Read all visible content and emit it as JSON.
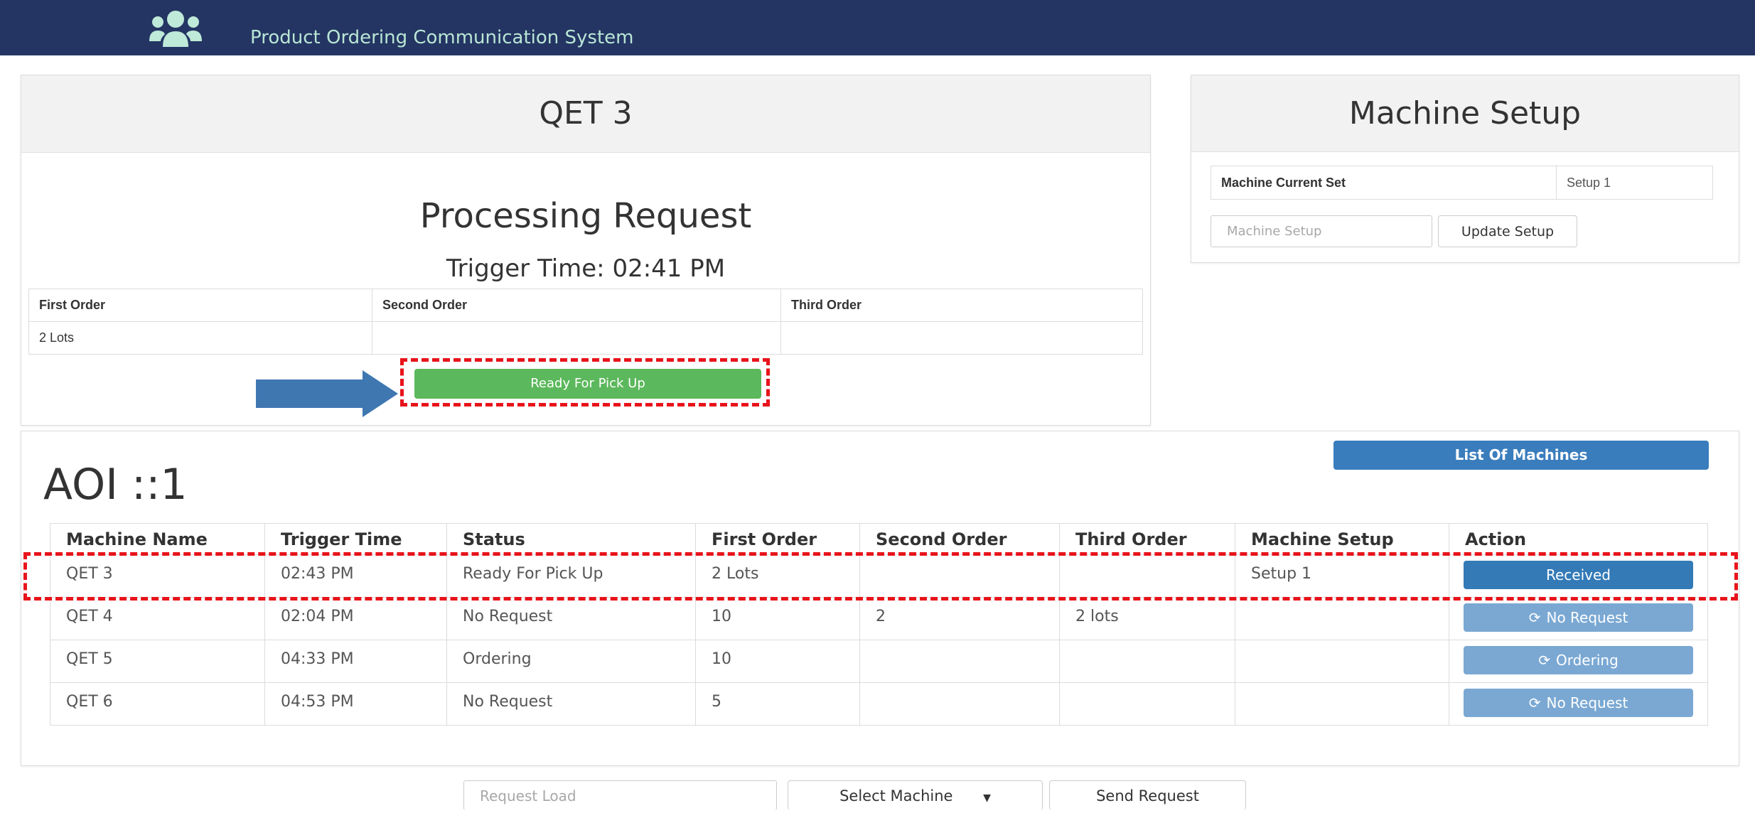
{
  "header": {
    "app_title": "Product Ordering Communication System",
    "logo_icon": "users-group-icon"
  },
  "processing_panel": {
    "title": "QET 3",
    "heading": "Processing Request",
    "trigger_label": "Trigger Time: 02:41 PM",
    "columns": [
      "First Order",
      "Second Order",
      "Third Order"
    ],
    "values": [
      "2 Lots",
      "",
      ""
    ],
    "status_button": "Ready For Pick Up"
  },
  "machine_setup": {
    "title": "Machine Setup",
    "current_label": "Machine Current Set",
    "current_value": "Setup 1",
    "input_placeholder": "Machine Setup",
    "update_button": "Update Setup"
  },
  "aoi": {
    "title": "AOI ::1",
    "list_button": "List Of Machines",
    "columns": [
      "Machine Name",
      "Trigger Time",
      "Status",
      "First Order",
      "Second Order",
      "Third Order",
      "Machine Setup",
      "Action"
    ],
    "rows": [
      {
        "name": "QET 3",
        "trigger": "02:43 PM",
        "status": "Ready For Pick Up",
        "first": "2 Lots",
        "second": "",
        "third": "",
        "setup": "Setup 1",
        "action": "Received"
      },
      {
        "name": "QET 4",
        "trigger": "02:04 PM",
        "status": "No Request",
        "first": "10",
        "second": "2",
        "third": "2 lots",
        "setup": "",
        "action": "No Request"
      },
      {
        "name": "QET 5",
        "trigger": "04:33 PM",
        "status": "Ordering",
        "first": "10",
        "second": "",
        "third": "",
        "setup": "",
        "action": "Ordering"
      },
      {
        "name": "QET 6",
        "trigger": "04:53 PM",
        "status": "No Request",
        "first": "5",
        "second": "",
        "third": "",
        "setup": "",
        "action": "No Request"
      }
    ]
  },
  "request_bar": {
    "load_placeholder": "Request Load",
    "select_value": "Select Machine",
    "send_button": "Send Request"
  },
  "colors": {
    "navbar": "#243563",
    "success": "#5cb85c",
    "primary": "#337ab7",
    "primary_disabled": "#7aa8d3",
    "annotation": "#e8131b",
    "arrow": "#3f77b1"
  }
}
